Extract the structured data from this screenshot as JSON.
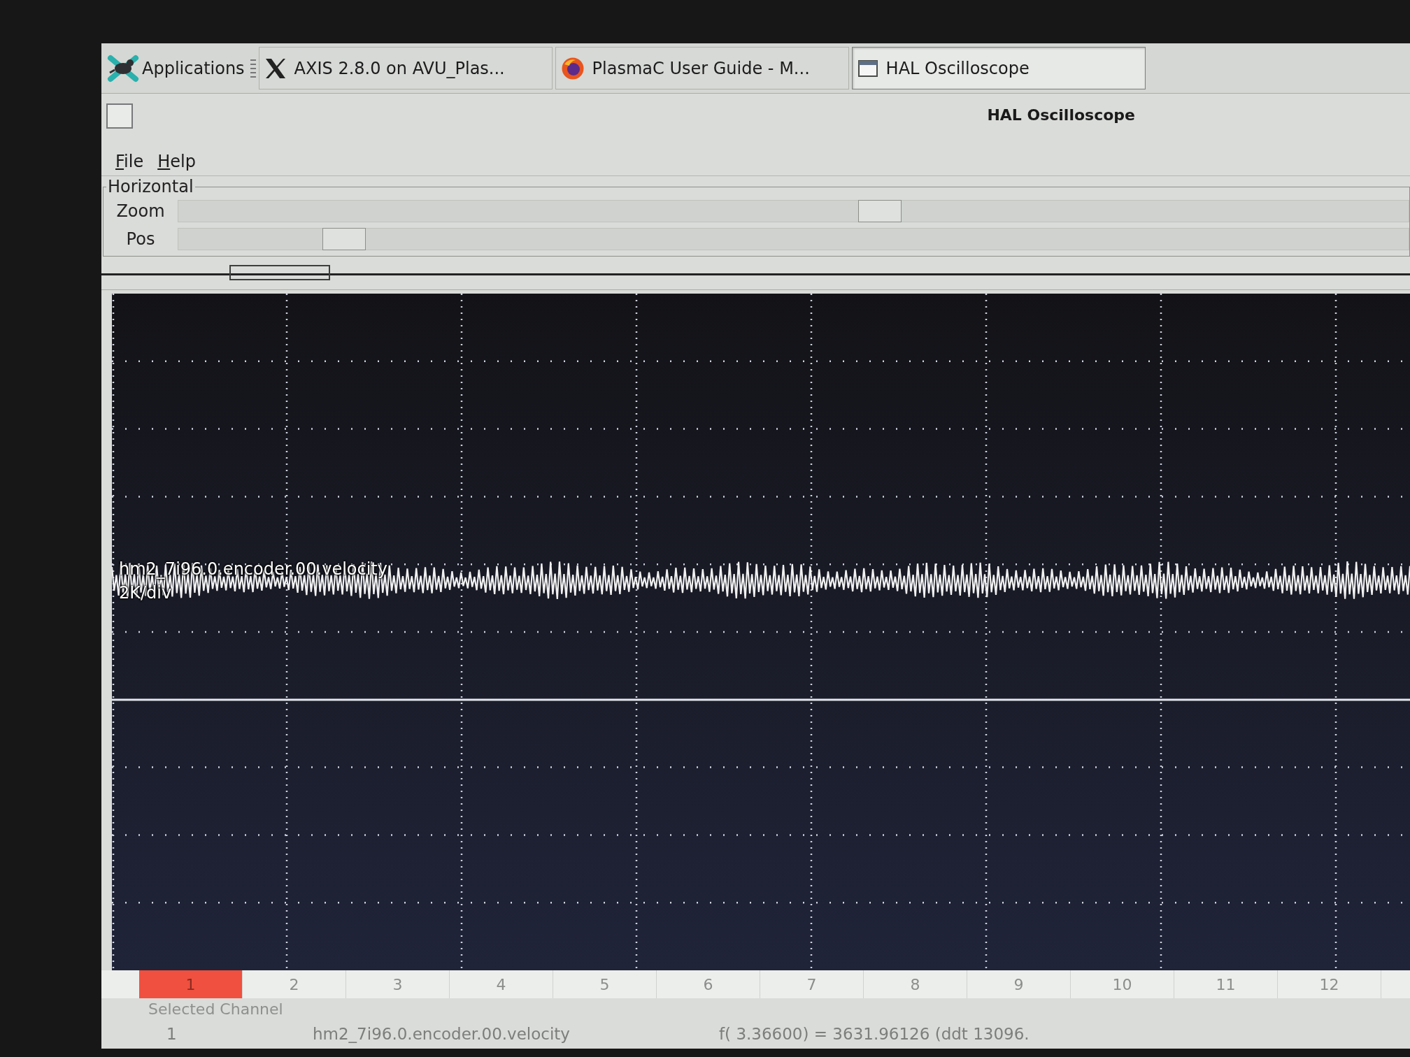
{
  "taskbar": {
    "applications_menu": {
      "label": "Applications"
    },
    "tasks": [
      {
        "kind": "x11",
        "label": "AXIS 2.8.0 on AVU_Plas...",
        "selected": false
      },
      {
        "kind": "browser",
        "label": "PlasmaC User Guide - M...",
        "selected": false
      },
      {
        "kind": "window",
        "label": "HAL Oscilloscope",
        "selected": true
      }
    ]
  },
  "window": {
    "title": "HAL Oscilloscope"
  },
  "menu": [
    "File",
    "Help"
  ],
  "horizontal": {
    "title": "Horizontal",
    "sliders": [
      {
        "label": "Zoom",
        "level": 0.57
      },
      {
        "label": "Pos",
        "level": 0.135
      }
    ]
  },
  "display": {
    "trace_label": "hm2_7i96.0.encoder.00.velocity",
    "scale": "2K/div"
  },
  "channels": [
    {
      "label": "1",
      "selected": true
    },
    {
      "label": "2",
      "selected": false
    },
    {
      "label": "3",
      "selected": false
    },
    {
      "label": "4",
      "selected": false
    },
    {
      "label": "5",
      "selected": false
    },
    {
      "label": "6",
      "selected": false
    },
    {
      "label": "7",
      "selected": false
    },
    {
      "label": "8",
      "selected": false
    },
    {
      "label": "9",
      "selected": false
    },
    {
      "label": "10",
      "selected": false
    },
    {
      "label": "11",
      "selected": false
    },
    {
      "label": "12",
      "selected": false
    }
  ],
  "selected_channel": {
    "title": "Selected Channel",
    "number": "1",
    "name": "hm2_7i96.0.encoder.00.velocity",
    "readout": "f( 3.36600) = 3631.96126 (ddt 13096."
  }
}
